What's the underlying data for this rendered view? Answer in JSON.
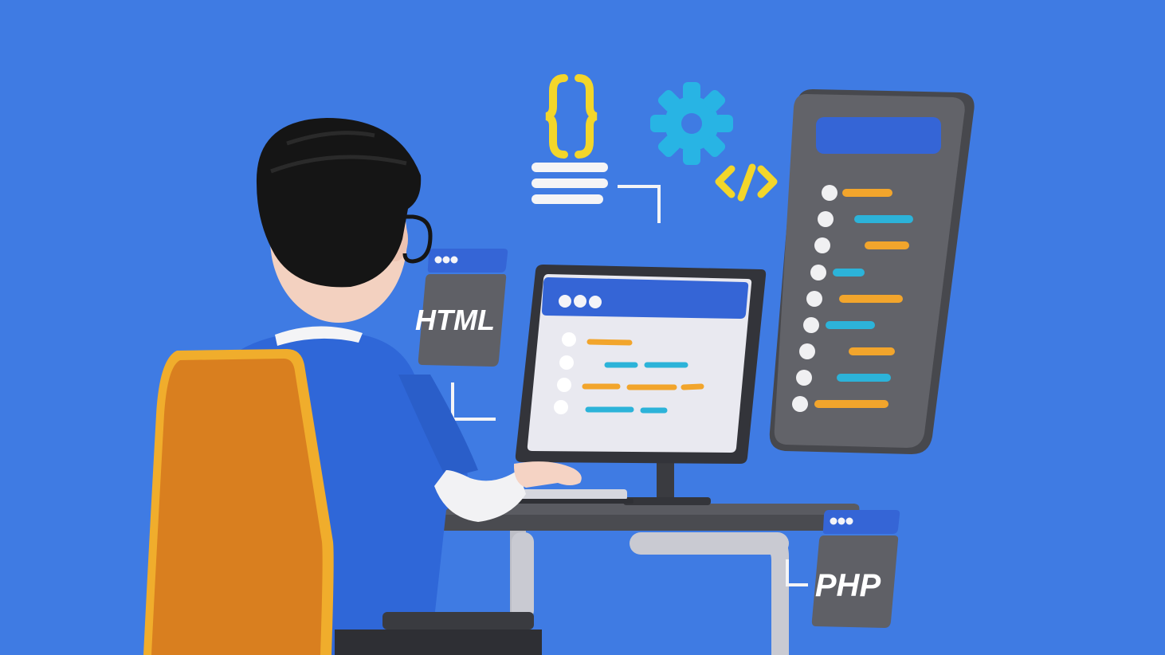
{
  "colors": {
    "background": "#3f7be3",
    "accent_blue": "#3565d6",
    "panel_gray": "#5f6066",
    "code_orange": "#f2a52c",
    "code_cyan": "#2cb3d9",
    "chair_orange": "#d97f1f",
    "chair_edge": "#f0ad2c",
    "gear_cyan": "#28b4e4",
    "braces_yellow": "#f3d62a"
  },
  "badges": {
    "html_label": "HTML",
    "php_label": "PHP"
  },
  "icons": {
    "braces": "curly-braces-icon",
    "gear": "gear-icon",
    "code_tag": "code-tag-icon",
    "text_lines": "text-lines-icon"
  }
}
